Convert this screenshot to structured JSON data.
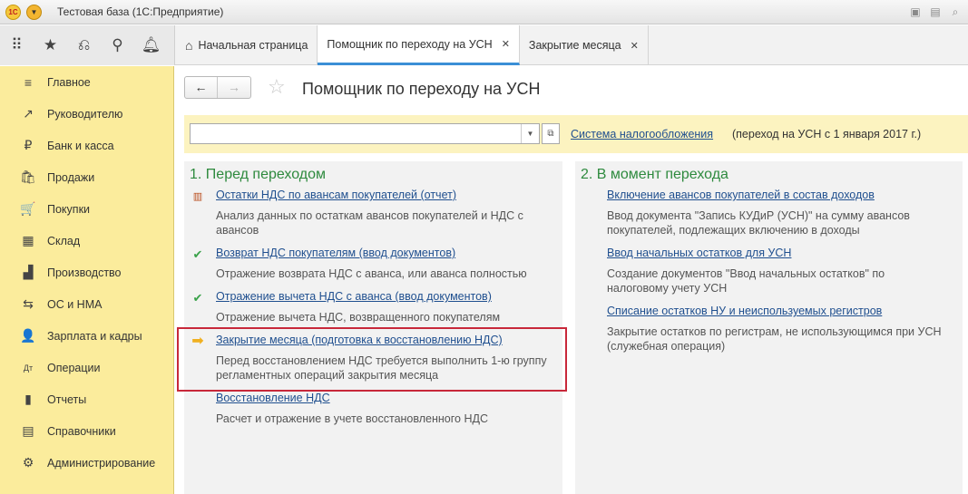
{
  "window": {
    "title": "Тестовая база  (1С:Предприятие)",
    "logo_text": "1С"
  },
  "tabs": [
    {
      "label": "Начальная страница"
    },
    {
      "label": "Помощник по переходу на УСН"
    },
    {
      "label": "Закрытие месяца"
    }
  ],
  "sidebar": {
    "items": [
      {
        "label": "Главное",
        "icon": "≡"
      },
      {
        "label": "Руководителю",
        "icon": "↗"
      },
      {
        "label": "Банк и касса",
        "icon": "₽"
      },
      {
        "label": "Продажи",
        "icon": "🛍"
      },
      {
        "label": "Покупки",
        "icon": "🛒"
      },
      {
        "label": "Склад",
        "icon": "▦"
      },
      {
        "label": "Производство",
        "icon": "▟"
      },
      {
        "label": "ОС и НМА",
        "icon": "⇆"
      },
      {
        "label": "Зарплата и кадры",
        "icon": "👤"
      },
      {
        "label": "Операции",
        "icon": "Дт"
      },
      {
        "label": "Отчеты",
        "icon": "▮"
      },
      {
        "label": "Справочники",
        "icon": "▤"
      },
      {
        "label": "Администрирование",
        "icon": "⚙"
      }
    ]
  },
  "page": {
    "title": "Помощник по переходу на УСН"
  },
  "filter": {
    "combo_value": "",
    "tax_link": "Система налогообложения",
    "tax_note": "(переход на УСН с 1 января 2017 г.)"
  },
  "left_panel": {
    "heading": "1. Перед переходом",
    "steps": [
      {
        "link": "Остатки НДС по авансам покупателей (отчет)",
        "desc": "Анализ данных по остаткам авансов покупателей и НДС с авансов",
        "icon": "report"
      },
      {
        "link": "Возврат НДС покупателям (ввод документов)",
        "desc": "Отражение возврата НДС с аванса, или аванса полностью",
        "icon": "check"
      },
      {
        "link": "Отражение вычета НДС с аванса (ввод документов)",
        "desc": "Отражение вычета НДС, возвращенного покупателям",
        "icon": "check"
      },
      {
        "link": "Закрытие месяца (подготовка к восстановлению НДС)",
        "desc": "Перед восстановлением НДС требуется выполнить 1-ю группу регламентных операций закрытия месяца",
        "icon": "arrow"
      },
      {
        "link": "Восстановление НДС",
        "desc": "Расчет и отражение в учете восстановленного НДС",
        "icon": "none"
      }
    ]
  },
  "right_panel": {
    "heading": "2. В момент перехода",
    "steps": [
      {
        "link": "Включение авансов покупателей в состав доходов",
        "desc": "Ввод документа \"Запись КУДиР (УСН)\" на сумму авансов покупателей, подлежащих включению в доходы"
      },
      {
        "link": "Ввод начальных остатков для УСН",
        "desc": "Создание документов \"Ввод начальных остатков\" по налоговому учету УСН"
      },
      {
        "link": "Списание остатков НУ и неиспользуемых регистров",
        "desc": "Закрытие остатков по  регистрам, не использующимся при УСН (служебная операция)"
      }
    ]
  }
}
